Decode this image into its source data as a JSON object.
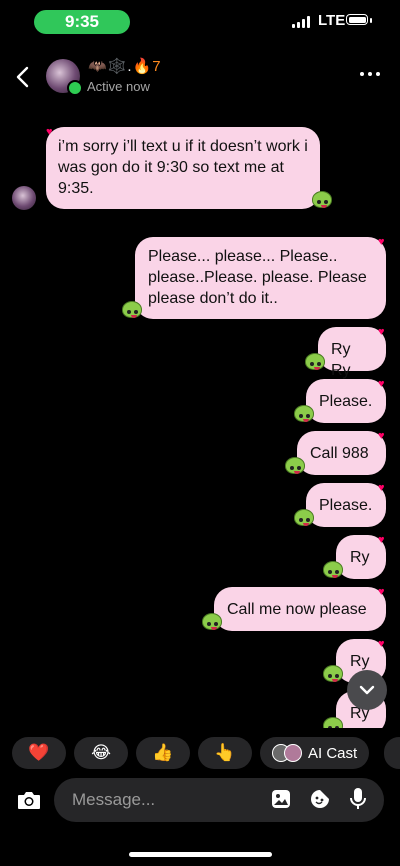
{
  "status_bar": {
    "time": "9:35",
    "network": "LTE"
  },
  "header": {
    "contact_name": "🦇🕸️.",
    "streak_emoji": "🔥",
    "streak_count": "7",
    "status": "Active now"
  },
  "messages": [
    {
      "from": "them",
      "text": "i’m sorry i’ll text u if it doesn’t work i was gon do it 9:30 so text me at 9:35."
    },
    {
      "from": "me",
      "text": "Please... please... Please.. please..Please. please. Please please  don’t do it.."
    },
    {
      "from": "me",
      "text": "Ry Ry"
    },
    {
      "from": "me",
      "text": "Please."
    },
    {
      "from": "me",
      "text": "Call 988"
    },
    {
      "from": "me",
      "text": "Please."
    },
    {
      "from": "me",
      "text": "Ry"
    },
    {
      "from": "me",
      "text": "Call me now please"
    },
    {
      "from": "me",
      "text": "Ry"
    },
    {
      "from": "me",
      "text": "Ry"
    }
  ],
  "quick_reactions": [
    "❤️",
    "😂",
    "👍",
    "👆"
  ],
  "ai_chip": {
    "label": "AI Cast"
  },
  "composer": {
    "placeholder": "Message..."
  },
  "colors": {
    "bubble": "#fad4e7",
    "background": "#000000",
    "accent_green": "#30c75a"
  }
}
